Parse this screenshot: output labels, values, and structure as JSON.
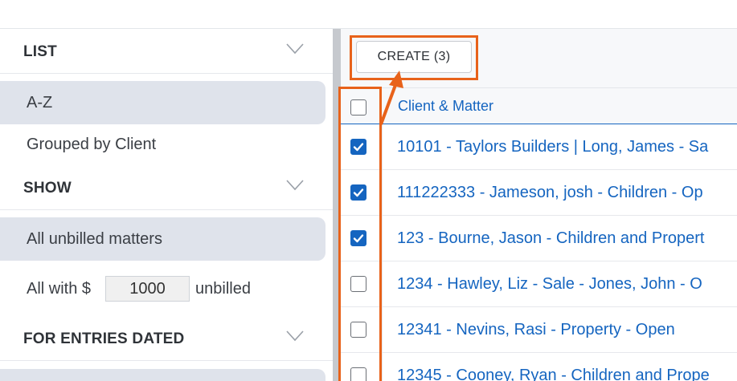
{
  "sidebar": {
    "list": {
      "title": "LIST",
      "options": [
        "A-Z",
        "Grouped by Client"
      ],
      "selected": "A-Z"
    },
    "show": {
      "title": "SHOW",
      "options": [
        "All unbilled matters"
      ],
      "selected": "All unbilled matters",
      "amount_prefix": "All with $",
      "amount_value": "1000",
      "amount_suffix": "unbilled"
    },
    "entries": {
      "title": "FOR ENTRIES DATED"
    }
  },
  "toolbar": {
    "create_label": "CREATE (3)"
  },
  "table": {
    "column_header": "Client & Matter",
    "rows": [
      {
        "text": "10101 - Taylors Builders | Long, James - Sa",
        "checked": true
      },
      {
        "text": "111222333 - Jameson, josh - Children - Op",
        "checked": true
      },
      {
        "text": "123 - Bourne, Jason - Children and Propert",
        "checked": true
      },
      {
        "text": "1234 - Hawley, Liz - Sale - Jones, John - O",
        "checked": false
      },
      {
        "text": "12341 - Nevins, Rasi - Property - Open",
        "checked": false
      },
      {
        "text": "12345 - Cooney, Ryan - Children and Prope",
        "checked": false
      }
    ]
  },
  "colors": {
    "accent": "#1565c0",
    "callout": "#e8621a",
    "selected_bg": "#dfe3eb"
  }
}
